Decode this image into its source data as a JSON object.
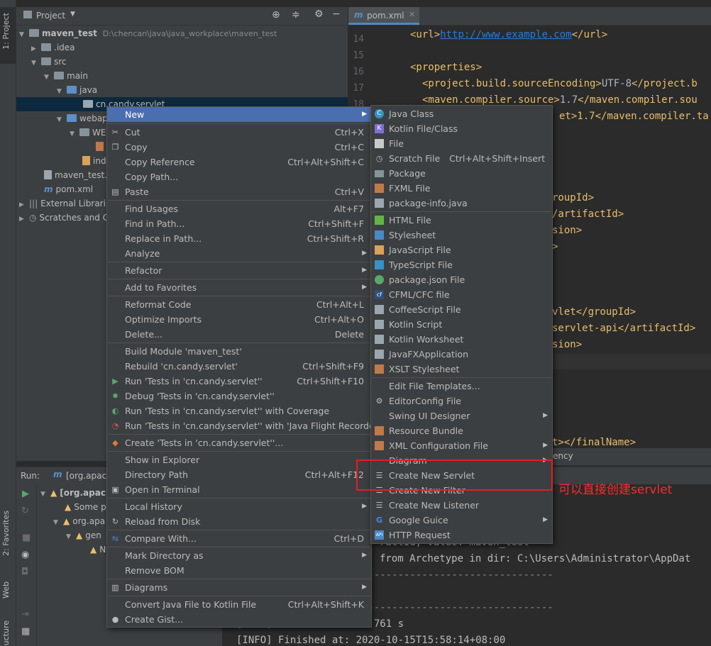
{
  "colors": {
    "accent": "#4b6eaf",
    "annotation": "#e02020",
    "tag": "#e8bf6a",
    "link": "#287bde"
  },
  "left_strip": {
    "project_tab": "1: Project",
    "favorites_tab": "2: Favorites",
    "web_tab": "Web",
    "structure_tab": "ucture"
  },
  "project_panel": {
    "title": "Project",
    "tree": [
      {
        "label": "maven_test",
        "path": "D:\\chencan\\java\\java_workplace\\maven_test",
        "icon": "module-folder-icon"
      },
      {
        "label": ".idea",
        "icon": "folder-icon"
      },
      {
        "label": "src",
        "icon": "folder-icon"
      },
      {
        "label": "main",
        "icon": "folder-icon"
      },
      {
        "label": "java",
        "icon": "source-folder-icon"
      },
      {
        "label": "cn.candy.servlet",
        "icon": "package-icon"
      },
      {
        "label": "webap",
        "icon": "web-folder-icon"
      },
      {
        "label": "WE",
        "icon": "folder-icon"
      },
      {
        "label": "ind",
        "icon": "jsp-file-icon"
      },
      {
        "label": "maven_test.i",
        "icon": "iml-file-icon"
      },
      {
        "label": "pom.xml",
        "icon": "maven-icon"
      },
      {
        "label": "External Librari",
        "icon": "library-icon"
      },
      {
        "label": "Scratches and C",
        "icon": "scratches-icon"
      }
    ]
  },
  "editor": {
    "tab": "pom.xml",
    "line_numbers": [
      "14",
      "15",
      "16",
      "17",
      "18"
    ],
    "lines": [
      {
        "open": "<url>",
        "text": "http://www.example.com",
        "close": "</url>"
      },
      {
        "open": "",
        "text": "",
        "close": ""
      },
      {
        "open": "<properties>",
        "text": "",
        "close": ""
      },
      {
        "open": "<project.build.sourceEncoding>",
        "text": "UTF-8",
        "close": "</project.b"
      },
      {
        "open": "<maven.compiler.source>",
        "text": "1.7",
        "close": "</maven.compiler.sou"
      }
    ],
    "fragments": [
      "et>1.7</maven.compiler.ta",
      "roupId>",
      "/artifactId>",
      "sion>",
      ">",
      "vlet</groupId>",
      "servlet-api</artifactId>",
      "sion>",
      "t></finalName>",
      "ency"
    ]
  },
  "run_panel": {
    "title": "Run:",
    "config": "[org.apac",
    "tree": [
      "[org.apac",
      "Some p",
      "org.apa",
      "gen",
      "N"
    ],
    "console": [
      "ractId, value: maven_test",
      "from Archetype in dir: C:\\Users\\Administrator\\AppDat",
      "-----------------------------------------------------",
      "-----------------------------------------------------",
      "[INFO] Total time:  01:761 s",
      "[INFO] Finished at: 2020-10-15T15:58:14+08:00"
    ]
  },
  "context_menu": {
    "items": [
      {
        "label": "New",
        "shortcut": "",
        "submenu": true,
        "icon": ""
      },
      {
        "label": "Cut",
        "shortcut": "Ctrl+X",
        "icon": "cut-icon"
      },
      {
        "label": "Copy",
        "shortcut": "Ctrl+C",
        "icon": "copy-icon"
      },
      {
        "label": "Copy Reference",
        "shortcut": "Ctrl+Alt+Shift+C",
        "icon": ""
      },
      {
        "label": "Copy Path...",
        "shortcut": "",
        "icon": ""
      },
      {
        "label": "Paste",
        "shortcut": "Ctrl+V",
        "icon": "paste-icon"
      },
      {
        "label": "Find Usages",
        "shortcut": "Alt+F7",
        "icon": ""
      },
      {
        "label": "Find in Path...",
        "shortcut": "Ctrl+Shift+F",
        "icon": ""
      },
      {
        "label": "Replace in Path...",
        "shortcut": "Ctrl+Shift+R",
        "icon": ""
      },
      {
        "label": "Analyze",
        "shortcut": "",
        "submenu": true,
        "icon": ""
      },
      {
        "label": "Refactor",
        "shortcut": "",
        "submenu": true,
        "icon": ""
      },
      {
        "label": "Add to Favorites",
        "shortcut": "",
        "submenu": true,
        "icon": ""
      },
      {
        "label": "Reformat Code",
        "shortcut": "Ctrl+Alt+L",
        "icon": ""
      },
      {
        "label": "Optimize Imports",
        "shortcut": "Ctrl+Alt+O",
        "icon": ""
      },
      {
        "label": "Delete...",
        "shortcut": "Delete",
        "icon": ""
      },
      {
        "label": "Build Module 'maven_test'",
        "shortcut": "",
        "icon": ""
      },
      {
        "label": "Rebuild 'cn.candy.servlet'",
        "shortcut": "Ctrl+Shift+F9",
        "icon": ""
      },
      {
        "label": "Run 'Tests in 'cn.candy.servlet''",
        "shortcut": "Ctrl+Shift+F10",
        "icon": "run-icon"
      },
      {
        "label": "Debug 'Tests in 'cn.candy.servlet''",
        "shortcut": "",
        "icon": "debug-icon"
      },
      {
        "label": "Run 'Tests in 'cn.candy.servlet'' with Coverage",
        "shortcut": "",
        "icon": "coverage-icon"
      },
      {
        "label": "Run 'Tests in 'cn.candy.servlet'' with 'Java Flight Recorder'",
        "shortcut": "",
        "icon": "flight-recorder-icon"
      },
      {
        "label": "Create 'Tests in 'cn.candy.servlet''...",
        "shortcut": "",
        "icon": "create-test-icon"
      },
      {
        "label": "Show in Explorer",
        "shortcut": "",
        "icon": ""
      },
      {
        "label": "Directory Path",
        "shortcut": "Ctrl+Alt+F12",
        "icon": ""
      },
      {
        "label": "Open in Terminal",
        "shortcut": "",
        "icon": "terminal-icon"
      },
      {
        "label": "Local History",
        "shortcut": "",
        "submenu": true,
        "icon": ""
      },
      {
        "label": "Reload from Disk",
        "shortcut": "",
        "icon": "reload-icon"
      },
      {
        "label": "Compare With...",
        "shortcut": "Ctrl+D",
        "icon": "compare-icon"
      },
      {
        "label": "Mark Directory as",
        "shortcut": "",
        "submenu": true,
        "icon": ""
      },
      {
        "label": "Remove BOM",
        "shortcut": "",
        "icon": ""
      },
      {
        "label": "Diagrams",
        "shortcut": "",
        "submenu": true,
        "icon": "diagrams-icon"
      },
      {
        "label": "Convert Java File to Kotlin File",
        "shortcut": "Ctrl+Alt+Shift+K",
        "icon": ""
      },
      {
        "label": "Create Gist...",
        "shortcut": "",
        "icon": "github-icon"
      }
    ]
  },
  "new_submenu": {
    "items": [
      {
        "label": "Java Class",
        "shortcut": "",
        "icon": "java-class-icon"
      },
      {
        "label": "Kotlin File/Class",
        "shortcut": "",
        "icon": "kotlin-icon"
      },
      {
        "label": "File",
        "shortcut": "",
        "icon": "file-icon"
      },
      {
        "label": "Scratch File",
        "shortcut": "Ctrl+Alt+Shift+Insert",
        "icon": "scratch-icon"
      },
      {
        "label": "Package",
        "shortcut": "",
        "icon": "package-icon"
      },
      {
        "label": "FXML File",
        "shortcut": "",
        "icon": "fxml-icon"
      },
      {
        "label": "package-info.java",
        "shortcut": "",
        "icon": "package-info-icon"
      },
      {
        "label": "HTML File",
        "shortcut": "",
        "icon": "html-icon"
      },
      {
        "label": "Stylesheet",
        "shortcut": "",
        "icon": "css-icon"
      },
      {
        "label": "JavaScript File",
        "shortcut": "",
        "icon": "javascript-icon"
      },
      {
        "label": "TypeScript File",
        "shortcut": "",
        "icon": "typescript-icon"
      },
      {
        "label": "package.json File",
        "shortcut": "",
        "icon": "npm-icon"
      },
      {
        "label": "CFML/CFC file",
        "shortcut": "",
        "icon": "cfml-icon"
      },
      {
        "label": "CoffeeScript File",
        "shortcut": "",
        "icon": "coffeescript-icon"
      },
      {
        "label": "Kotlin Script",
        "shortcut": "",
        "icon": "kotlin-script-icon"
      },
      {
        "label": "Kotlin Worksheet",
        "shortcut": "",
        "icon": "kotlin-worksheet-icon"
      },
      {
        "label": "JavaFXApplication",
        "shortcut": "",
        "icon": "javafx-icon"
      },
      {
        "label": "XSLT Stylesheet",
        "shortcut": "",
        "icon": "xslt-icon"
      },
      {
        "label": "Edit File Templates...",
        "shortcut": "",
        "icon": ""
      },
      {
        "label": "EditorConfig File",
        "shortcut": "",
        "icon": "editorconfig-icon"
      },
      {
        "label": "Swing UI Designer",
        "shortcut": "",
        "submenu": true,
        "icon": ""
      },
      {
        "label": "Resource Bundle",
        "shortcut": "",
        "icon": "resource-bundle-icon"
      },
      {
        "label": "XML Configuration File",
        "shortcut": "",
        "submenu": true,
        "icon": "xml-config-icon"
      },
      {
        "label": "Diagram",
        "shortcut": "",
        "submenu": true,
        "icon": ""
      },
      {
        "label": "Create New Servlet",
        "shortcut": "",
        "icon": "servlet-icon"
      },
      {
        "label": "Create New Filter",
        "shortcut": "",
        "icon": "filter-icon"
      },
      {
        "label": "Create New Listener",
        "shortcut": "",
        "icon": "listener-icon"
      },
      {
        "label": "Google Guice",
        "shortcut": "",
        "submenu": true,
        "icon": "google-icon"
      },
      {
        "label": "HTTP Request",
        "shortcut": "",
        "icon": "http-request-icon"
      }
    ]
  },
  "annotation": {
    "text": "可以直接创建servlet"
  }
}
